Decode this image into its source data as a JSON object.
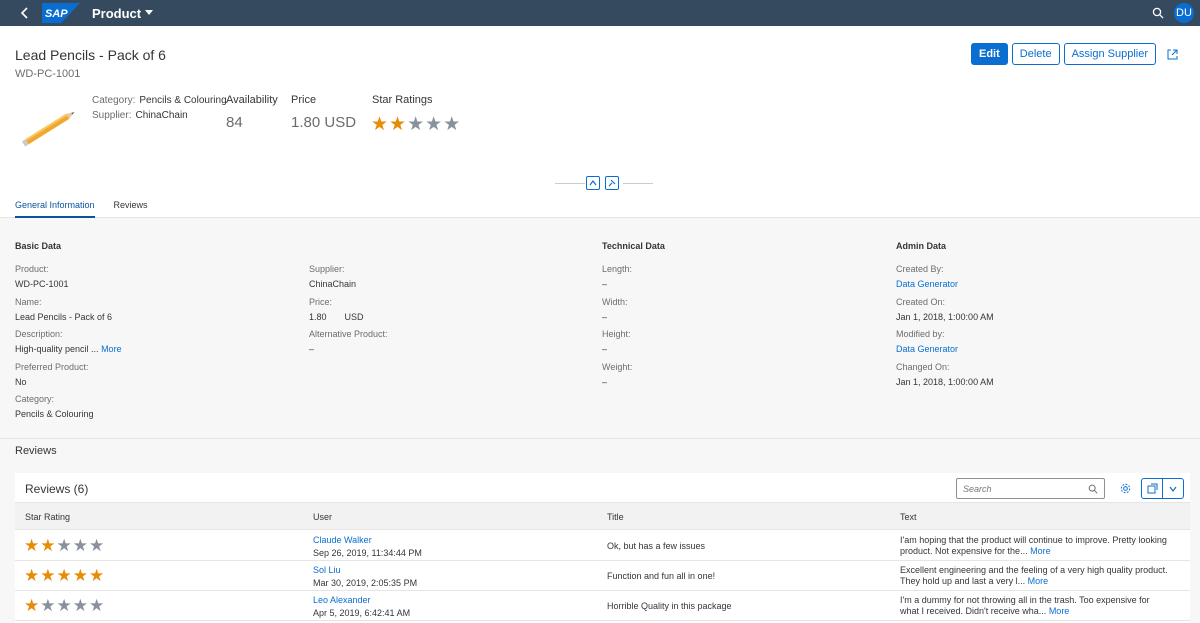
{
  "shell": {
    "logo": "SAP",
    "app_title": "Product",
    "avatar": "DU"
  },
  "header": {
    "title": "Lead Pencils - Pack of 6",
    "subtitle": "WD-PC-1001",
    "actions": {
      "edit": "Edit",
      "delete": "Delete",
      "assign_supplier": "Assign Supplier"
    },
    "category_label": "Category:",
    "category_value": "Pencils & Colouring",
    "supplier_label": "Supplier:",
    "supplier_value": "ChinaChain",
    "kpis": {
      "availability_label": "Availability",
      "availability_value": "84",
      "price_label": "Price",
      "price_value": "1.80 USD",
      "rating_label": "Star Ratings",
      "rating_value": 2,
      "rating_max": 5
    },
    "tabs": [
      "General Information",
      "Reviews"
    ]
  },
  "sections": {
    "basic_title": "Basic Data",
    "technical_title": "Technical Data",
    "admin_title": "Admin Data",
    "basic_col1": [
      {
        "label": "Product:",
        "value": "WD-PC-1001"
      },
      {
        "label": "Name:",
        "value": "Lead Pencils - Pack of 6"
      },
      {
        "label": "Description:",
        "value": "High-quality pencil ...",
        "more": "More"
      },
      {
        "label": "Preferred Product:",
        "value": "No"
      },
      {
        "label": "Category:",
        "value": "Pencils & Colouring"
      }
    ],
    "basic_col2": [
      {
        "label": "Supplier:",
        "value": "ChinaChain"
      },
      {
        "label": "Price:",
        "value": "1.80",
        "unit": "USD"
      },
      {
        "label": "Alternative Product:",
        "value": "–"
      }
    ],
    "technical": [
      {
        "label": "Length:",
        "value": "–"
      },
      {
        "label": "Width:",
        "value": "–"
      },
      {
        "label": "Height:",
        "value": "–"
      },
      {
        "label": "Weight:",
        "value": "–"
      }
    ],
    "admin": [
      {
        "label": "Created By:",
        "value": "Data Generator"
      },
      {
        "label": "Created On:",
        "value": "Jan 1, 2018, 1:00:00 AM"
      },
      {
        "label": "Modified by:",
        "value": "Data Generator"
      },
      {
        "label": "Changed On:",
        "value": "Jan 1, 2018, 1:00:00 AM"
      }
    ]
  },
  "reviews": {
    "section_title": "Reviews",
    "table_title": "Reviews (6)",
    "search_placeholder": "Search",
    "columns": [
      "Star Rating",
      "User",
      "Title",
      "Text"
    ],
    "rows": [
      {
        "rating": 2,
        "user": "Claude Walker",
        "date": "Sep 26, 2019, 11:34:44 PM",
        "title": "Ok, but has a few issues",
        "text": "I'am hoping that the product will continue to improve. Pretty looking product. Not expensive for the...",
        "more": "More"
      },
      {
        "rating": 5,
        "user": "Sol Liu",
        "date": "Mar 30, 2019, 2:05:35 PM",
        "title": "Function and fun all in one!",
        "text": "Excellent engineering and the feeling of a very high quality product. They hold up and last a very l...",
        "more": "More"
      },
      {
        "rating": 1,
        "user": "Leo Alexander",
        "date": "Apr 5, 2019, 6:42:41 AM",
        "title": "Horrible Quality in this package",
        "text": "I'm a dummy for not throwing all in the trash. Too expensive for what I received. Didn't receive wha...",
        "more": "More"
      }
    ]
  },
  "colors": {
    "shell": "#354a5f",
    "accent": "#0a6ed1",
    "star_on": "#e78c07",
    "star_off": "#89919a"
  }
}
